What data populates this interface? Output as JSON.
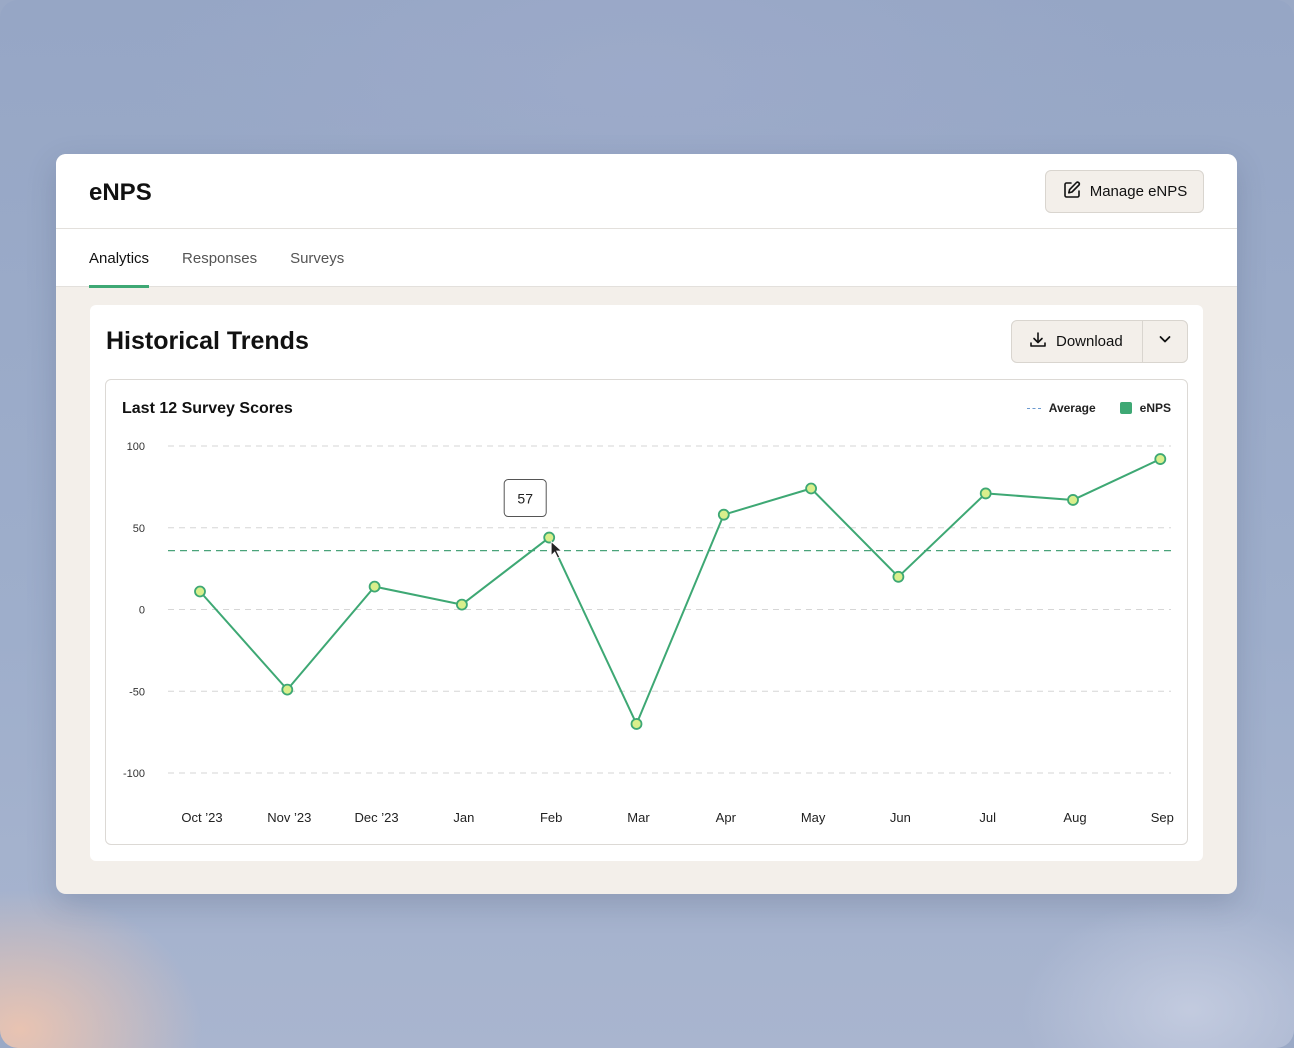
{
  "app": {
    "title": "eNPS",
    "manage_label": "Manage eNPS"
  },
  "tabs": [
    {
      "label": "Analytics",
      "active": true
    },
    {
      "label": "Responses",
      "active": false
    },
    {
      "label": "Surveys",
      "active": false
    }
  ],
  "panel": {
    "title": "Historical Trends",
    "download_label": "Download"
  },
  "colors": {
    "accent": "#3ea874",
    "point_fill": "#d9ef8c",
    "average_line": "#4aa37a",
    "grid": "#d6d6d6"
  },
  "chart_data": {
    "type": "line",
    "title": "Last 12 Survey Scores",
    "legend": [
      "Average",
      "eNPS"
    ],
    "legend_position": "top-right",
    "categories": [
      "Oct '23",
      "Nov '23",
      "Dec '23",
      "Jan",
      "Feb",
      "Mar",
      "Apr",
      "May",
      "Jun",
      "Jul",
      "Aug",
      "Sep"
    ],
    "series": [
      {
        "name": "eNPS",
        "values": [
          11,
          -49,
          14,
          3,
          44,
          -70,
          58,
          74,
          20,
          71,
          67,
          92
        ]
      }
    ],
    "average": 36,
    "ylim": [
      -100,
      100
    ],
    "yticks": [
      100,
      50,
      0,
      -50,
      -100
    ],
    "grid": true,
    "tooltip": {
      "category": "Feb",
      "label": "57"
    }
  }
}
